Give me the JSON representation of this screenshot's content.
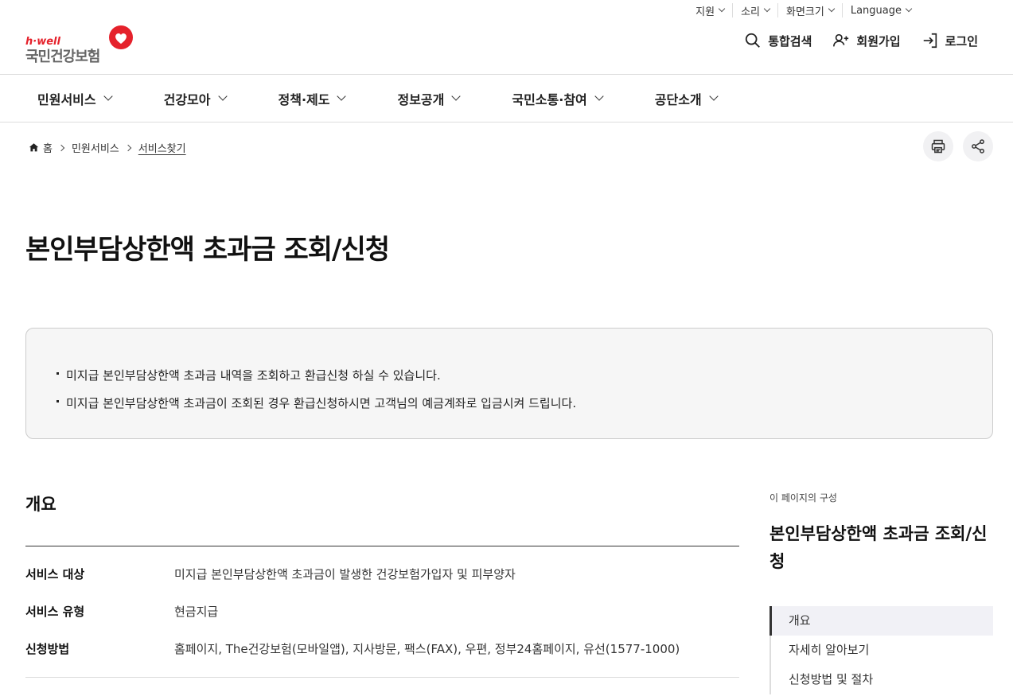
{
  "utility": {
    "items": [
      {
        "label": "지원"
      },
      {
        "label": "소리"
      },
      {
        "label": "화면크기"
      },
      {
        "label": "Language"
      }
    ]
  },
  "logo": {
    "tagline": "h·well",
    "name": "국민건강보험",
    "brand_color": "#e5212b"
  },
  "header": {
    "actions": [
      {
        "label": "통합검색",
        "icon": "search-icon"
      },
      {
        "label": "회원가입",
        "icon": "user-add-icon"
      },
      {
        "label": "로그인",
        "icon": "login-icon"
      }
    ]
  },
  "gnb": {
    "menus": [
      {
        "label": "민원서비스"
      },
      {
        "label": "건강모아"
      },
      {
        "label": "정책·제도"
      },
      {
        "label": "정보공개"
      },
      {
        "label": "국민소통·참여"
      },
      {
        "label": "공단소개"
      }
    ]
  },
  "breadcrumb": {
    "home": "홈",
    "level1": "민원서비스",
    "current": "서비스찾기"
  },
  "tools": {
    "print_icon": "print-icon",
    "share_icon": "share-icon"
  },
  "page": {
    "title": "본인부담상한액 초과금 조회/신청"
  },
  "notice": {
    "items": [
      "미지급 본인부담상한액 초과금 내역을 조회하고 환급신청 하실 수 있습니다.",
      "미지급 본인부담상한액 초과금이 조회된 경우 환급신청하시면 고객님의 예금계좌로 입금시켜 드립니다."
    ]
  },
  "overview": {
    "heading": "개요",
    "rows": [
      {
        "key": "서비스 대상",
        "value": "미지급 본인부담상한액 초과금이 발생한 건강보험가입자 및 피부양자"
      },
      {
        "key": "서비스 유형",
        "value": "현금지급"
      },
      {
        "key": "신청방법",
        "value": "홈페이지, The건강보험(모바일앱), 지사방문, 팩스(FAX), 우편, 정부24홈페이지, 유선(1577-1000)"
      }
    ]
  },
  "toc": {
    "caption": "이 페이지의 구성",
    "title": "본인부담상한액 초과금 조회/신청",
    "items": [
      {
        "label": "개요",
        "active": true
      },
      {
        "label": "자세히 알아보기"
      },
      {
        "label": "신청방법 및 절차"
      }
    ]
  }
}
